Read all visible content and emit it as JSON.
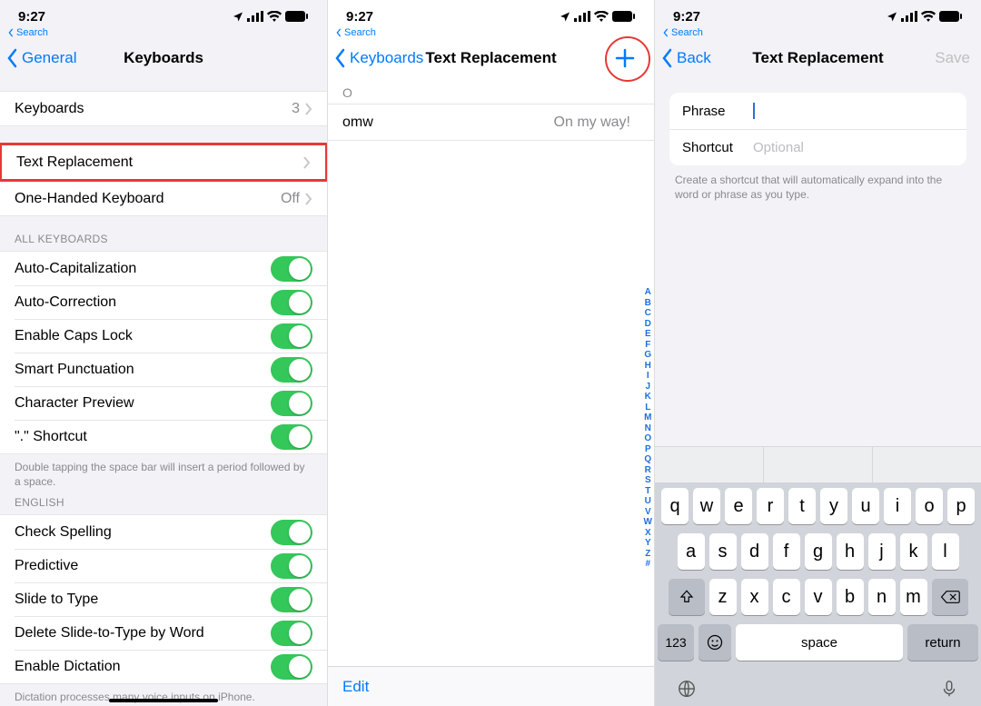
{
  "status": {
    "time": "9:27",
    "search_label": "Search"
  },
  "screen1": {
    "back": "General",
    "title": "Keyboards",
    "cells": {
      "keyboards": {
        "label": "Keyboards",
        "count": "3"
      },
      "text_replacement": {
        "label": "Text Replacement"
      },
      "one_handed": {
        "label": "One-Handed Keyboard",
        "value": "Off"
      }
    },
    "all_kb_header": "ALL KEYBOARDS",
    "toggles": [
      {
        "label": "Auto-Capitalization"
      },
      {
        "label": "Auto-Correction"
      },
      {
        "label": "Enable Caps Lock"
      },
      {
        "label": "Smart Punctuation"
      },
      {
        "label": "Character Preview"
      },
      {
        "label": "\".\" Shortcut"
      }
    ],
    "footer1": "Double tapping the space bar will insert a period followed by a space.",
    "english_header": "ENGLISH",
    "english_toggles": [
      {
        "label": "Check Spelling"
      },
      {
        "label": "Predictive"
      },
      {
        "label": "Slide to Type"
      },
      {
        "label": "Delete Slide-to-Type by Word"
      },
      {
        "label": "Enable Dictation"
      }
    ],
    "footer2": "Dictation processes many voice inputs on iPhone."
  },
  "screen2": {
    "back": "Keyboards",
    "title": "Text Replacement",
    "section_letter": "O",
    "entry": {
      "shortcut": "omw",
      "phrase": "On my way!"
    },
    "index": [
      "A",
      "B",
      "C",
      "D",
      "E",
      "F",
      "G",
      "H",
      "I",
      "J",
      "K",
      "L",
      "M",
      "N",
      "O",
      "P",
      "Q",
      "R",
      "S",
      "T",
      "U",
      "V",
      "W",
      "X",
      "Y",
      "Z",
      "#"
    ],
    "edit": "Edit"
  },
  "screen3": {
    "back": "Back",
    "title": "Text Replacement",
    "save": "Save",
    "phrase_label": "Phrase",
    "shortcut_label": "Shortcut",
    "shortcut_placeholder": "Optional",
    "help": "Create a shortcut that will automatically expand into the word or phrase as you type.",
    "keyboard": {
      "row1": [
        "q",
        "w",
        "e",
        "r",
        "t",
        "y",
        "u",
        "i",
        "o",
        "p"
      ],
      "row2": [
        "a",
        "s",
        "d",
        "f",
        "g",
        "h",
        "j",
        "k",
        "l"
      ],
      "row3": [
        "z",
        "x",
        "c",
        "v",
        "b",
        "n",
        "m"
      ],
      "numkey": "123",
      "space": "space",
      "return": "return"
    }
  }
}
